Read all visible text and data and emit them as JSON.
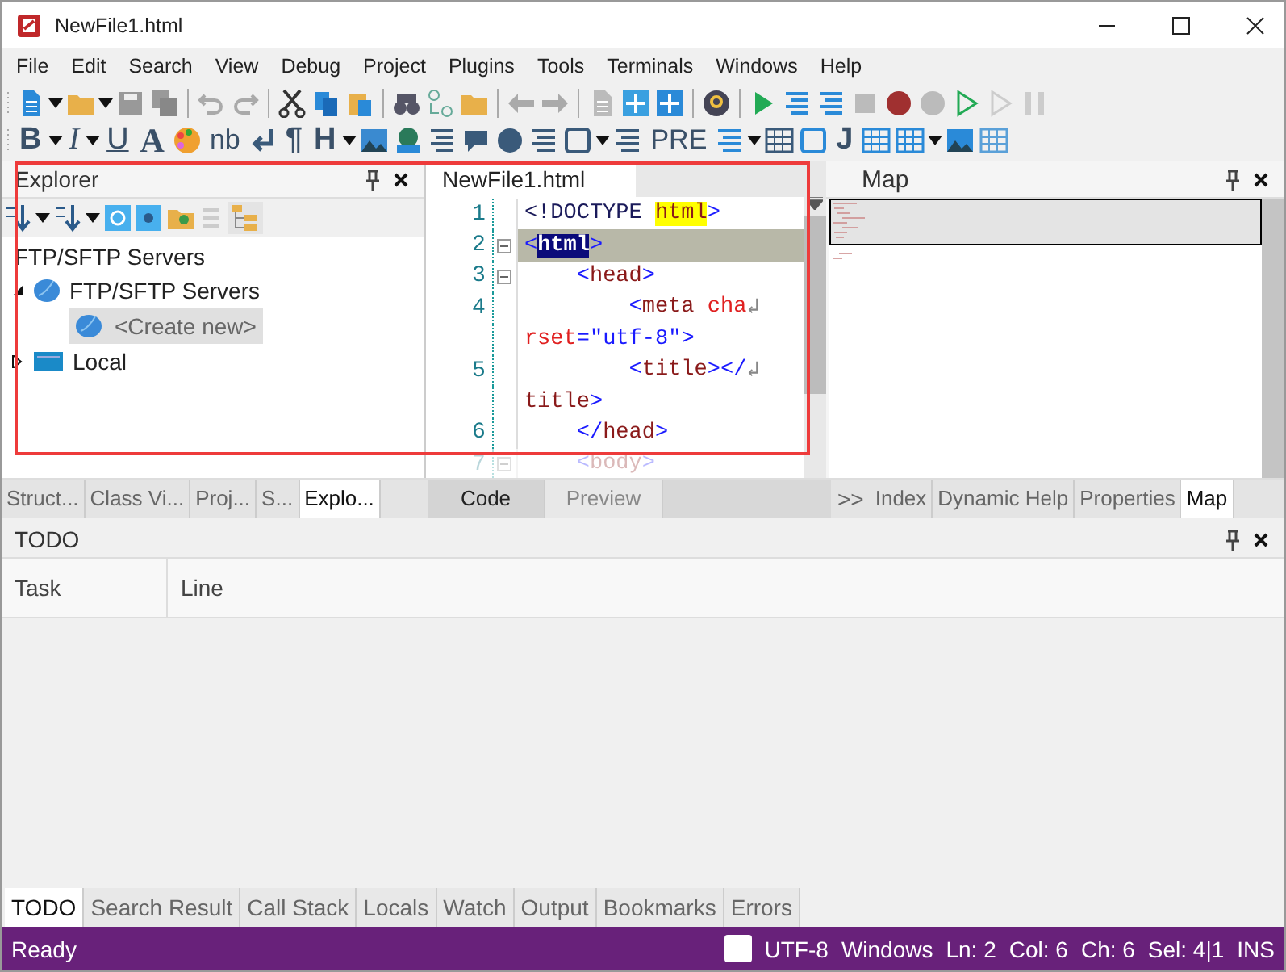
{
  "window": {
    "title": "NewFile1.html"
  },
  "menu": [
    "File",
    "Edit",
    "Search",
    "View",
    "Debug",
    "Project",
    "Plugins",
    "Tools",
    "Terminals",
    "Windows",
    "Help"
  ],
  "format_glyphs": [
    "B",
    "I",
    "U",
    "A",
    "nb",
    "¶",
    "H",
    "PRE",
    "J"
  ],
  "explorer": {
    "title": "Explorer",
    "root": "FTP/SFTP Servers",
    "tree": [
      {
        "label": "FTP/SFTP Servers",
        "kind": "server",
        "expanded": true,
        "selected": false,
        "children": [
          {
            "label": "<Create new>",
            "kind": "server",
            "selected": true
          }
        ]
      },
      {
        "label": "Local",
        "kind": "drive",
        "expanded": false,
        "selected": false
      }
    ]
  },
  "editor": {
    "tab": "NewFile1.html",
    "lines": [
      {
        "number": "1",
        "fold": false,
        "current": false,
        "dimmed": false,
        "segments": [
          {
            "kind": "doctype",
            "text": "<!DOCTYPE "
          },
          {
            "kind": "found",
            "text": "html"
          },
          {
            "kind": "bracket",
            "text": ">"
          }
        ]
      },
      {
        "number": "2",
        "fold": true,
        "current": true,
        "dimmed": false,
        "segments": [
          {
            "kind": "bracket",
            "text": "<"
          },
          {
            "kind": "selection",
            "text": "html"
          },
          {
            "kind": "bracket",
            "text": ">"
          }
        ]
      },
      {
        "number": "3",
        "fold": true,
        "current": false,
        "dimmed": false,
        "segments": [
          {
            "kind": "bracket",
            "text": "    <"
          },
          {
            "kind": "tag",
            "text": "head"
          },
          {
            "kind": "bracket",
            "text": ">"
          }
        ]
      },
      {
        "number": "4",
        "fold": false,
        "current": false,
        "dimmed": false,
        "segments": [
          {
            "kind": "bracket",
            "text": "        <"
          },
          {
            "kind": "tag",
            "text": "meta "
          },
          {
            "kind": "attr",
            "text": "cha"
          },
          {
            "kind": "wrap",
            "text": "↲"
          }
        ]
      },
      {
        "fold": false,
        "current": false,
        "dimmed": false,
        "segments": [
          {
            "kind": "attr",
            "text": "rset"
          },
          {
            "kind": "bracket",
            "text": "="
          },
          {
            "kind": "value",
            "text": "\"utf-8\""
          },
          {
            "kind": "bracket",
            "text": ">"
          }
        ]
      },
      {
        "number": "5",
        "fold": false,
        "current": false,
        "dimmed": false,
        "segments": [
          {
            "kind": "bracket",
            "text": "        <"
          },
          {
            "kind": "tag",
            "text": "title"
          },
          {
            "kind": "bracket",
            "text": "></"
          },
          {
            "kind": "wrap",
            "text": "↲"
          }
        ]
      },
      {
        "fold": false,
        "current": false,
        "dimmed": false,
        "segments": [
          {
            "kind": "tag",
            "text": "title"
          },
          {
            "kind": "bracket",
            "text": ">"
          }
        ]
      },
      {
        "number": "6",
        "fold": false,
        "current": false,
        "dimmed": false,
        "segments": [
          {
            "kind": "bracket",
            "text": "    </"
          },
          {
            "kind": "tag",
            "text": "head"
          },
          {
            "kind": "bracket",
            "text": ">"
          }
        ]
      },
      {
        "number": "7",
        "fold": true,
        "current": false,
        "dimmed": true,
        "segments": [
          {
            "kind": "bracket",
            "text": "    <"
          },
          {
            "kind": "tag",
            "text": "body"
          },
          {
            "kind": "bracket",
            "text": ">"
          }
        ]
      }
    ]
  },
  "map": {
    "title": "Map"
  },
  "left_tabs": [
    {
      "label": "Struct...",
      "selected": false
    },
    {
      "label": "Class Vi...",
      "selected": false
    },
    {
      "label": "Proj...",
      "selected": false
    },
    {
      "label": "S...",
      "selected": false
    },
    {
      "label": "Explo...",
      "selected": true
    }
  ],
  "editor_tabs": [
    {
      "label": "Code",
      "selected": true
    },
    {
      "label": "Preview",
      "selected": false
    }
  ],
  "right_tabs_overflow": ">>",
  "right_tabs": [
    {
      "label": "Index",
      "selected": false
    },
    {
      "label": "Dynamic Help",
      "selected": false
    },
    {
      "label": "Properties",
      "selected": false
    },
    {
      "label": "Map",
      "selected": true
    }
  ],
  "todo": {
    "title": "TODO",
    "columns": [
      "Task",
      "Line"
    ]
  },
  "bottom_tabs": [
    {
      "label": "TODO",
      "selected": true
    },
    {
      "label": "Search Result",
      "selected": false
    },
    {
      "label": "Call Stack",
      "selected": false
    },
    {
      "label": "Locals",
      "selected": false
    },
    {
      "label": "Watch",
      "selected": false
    },
    {
      "label": "Output",
      "selected": false
    },
    {
      "label": "Bookmarks",
      "selected": false
    },
    {
      "label": "Errors",
      "selected": false
    }
  ],
  "status_bar": {
    "message": "Ready",
    "checked": false,
    "items": [
      "UTF-8",
      "Windows",
      "Ln: 2",
      "Col: 6",
      "Ch: 6",
      "Sel: 4|1",
      "INS"
    ]
  }
}
